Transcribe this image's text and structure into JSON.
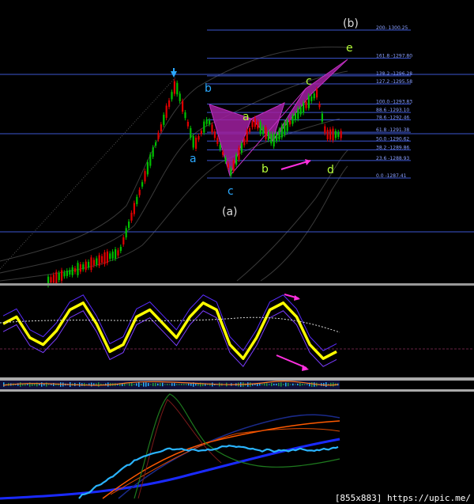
{
  "footer_text": "[855x883] https://upic.me/",
  "chart_data": [
    {
      "type": "candlestick",
      "title": "",
      "fib_levels": [
        {
          "label": "200- 1300.25",
          "ratio": 200.0,
          "price": 1300.25
        },
        {
          "label": "161.8 -1297.80",
          "ratio": 161.8,
          "price": 1297.8
        },
        {
          "label": "138.2 -1296.28",
          "ratio": 138.2,
          "price": 1296.28
        },
        {
          "label": "127.2 -1295.58",
          "ratio": 127.2,
          "price": 1295.58
        },
        {
          "label": "100.0 -1293.83",
          "ratio": 100.0,
          "price": 1293.83
        },
        {
          "label": "88.6 -1293.10",
          "ratio": 88.6,
          "price": 1293.1
        },
        {
          "label": "78.6 -1292.46",
          "ratio": 78.6,
          "price": 1292.46
        },
        {
          "label": "61.8 -1291.38",
          "ratio": 61.8,
          "price": 1291.38
        },
        {
          "label": "50.0 -1290.62",
          "ratio": 50.0,
          "price": 1290.62
        },
        {
          "label": "38.2 -1289.86",
          "ratio": 38.2,
          "price": 1289.86
        },
        {
          "label": "23.6 -1288.93",
          "ratio": 23.6,
          "price": 1288.93
        },
        {
          "label": "0.0 -1287.41",
          "ratio": 0.0,
          "price": 1287.41
        }
      ],
      "wave_labels": [
        {
          "text": "b",
          "color": "#2ba9ff"
        },
        {
          "text": "a",
          "color": "#2ba9ff"
        },
        {
          "text": "c",
          "color": "#2ba9ff"
        },
        {
          "text": "a",
          "color": "#b6ff3a"
        },
        {
          "text": "b",
          "color": "#b6ff3a"
        },
        {
          "text": "c",
          "color": "#b6ff3a"
        },
        {
          "text": "d",
          "color": "#b6ff3a"
        },
        {
          "text": "e",
          "color": "#b6ff3a"
        }
      ],
      "case_labels": [
        "(a)",
        "(b)"
      ],
      "colors": {
        "up_candle": "#00c000",
        "down_candle": "#e00000",
        "harmonic_fill": "#a020a0",
        "fib_line": "#3c56d0",
        "arrow": "#ff30e0",
        "top_marker": "#2ba9ff"
      }
    },
    {
      "type": "line",
      "title": "",
      "series": [
        {
          "color": "#ffff00"
        },
        {
          "color": "#6a3cff"
        }
      ],
      "y_indicator_oscillator": [
        0.6,
        0.7,
        0.4,
        0.3,
        0.5,
        0.8,
        0.9,
        0.6,
        0.2,
        0.3,
        0.7,
        0.8,
        0.6,
        0.4,
        0.7,
        0.9,
        0.8,
        0.3,
        0.1,
        0.4,
        0.8,
        0.9,
        0.7,
        0.3,
        0.1,
        0.2
      ]
    },
    {
      "type": "line",
      "title": "",
      "series": [
        {
          "color": "#2ab4ff"
        },
        {
          "color": "#1a2aff"
        },
        {
          "color": "#ff5a00"
        },
        {
          "color": "#1e7a1e"
        }
      ]
    }
  ]
}
